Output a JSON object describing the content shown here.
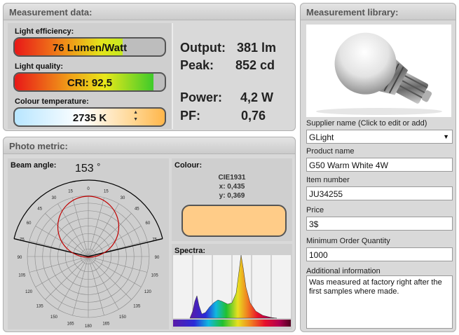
{
  "measurement_panel": {
    "title": "Measurement data:",
    "light_efficiency": {
      "label": "Light efficiency:",
      "value": "76 Lumen/Watt",
      "level": 0.72
    },
    "light_quality": {
      "label": "Light quality:",
      "value": "CRI:  92,5",
      "level": 0.925
    },
    "colour_temperature": {
      "label": "Colour temperature:",
      "value": "2735 K"
    },
    "readings": [
      {
        "label": "Output:",
        "value": "381 lm"
      },
      {
        "label": "Peak:",
        "value": "852 cd"
      },
      {
        "label": "Power:",
        "value": "4,2 W"
      },
      {
        "label": "PF:",
        "value": "0,76"
      }
    ]
  },
  "photo_panel": {
    "title": "Photo metric:",
    "beam_angle_label": "Beam angle:",
    "beam_angle_value": "153",
    "beam_angle_unit": "°",
    "polar_tick_labels": [
      "0",
      "15",
      "15",
      "30",
      "30",
      "45",
      "45",
      "60",
      "60",
      "75",
      "75",
      "90",
      "90",
      "105",
      "105",
      "120",
      "120",
      "135",
      "135",
      "150",
      "150",
      "165",
      "165",
      "180"
    ],
    "colour_label": "Colour:",
    "cie_title": "CIE1931",
    "cie_x": "x: 0,435",
    "cie_y": "y: 0,369",
    "swatch_color": "#ffcc88",
    "spectra_label": "Spectra:"
  },
  "library_panel": {
    "title": "Measurement library:",
    "fields": {
      "supplier_label": "Supplier name (Click to edit or add)",
      "supplier_value": "GLight",
      "product_label": "Product name",
      "product_value": "G50 Warm White 4W",
      "item_label": "Item number",
      "item_value": "JU34255",
      "price_label": "Price",
      "price_value": "3$",
      "moq_label": "Minimum Order Quantity",
      "moq_value": "1000",
      "info_label": "Additional information",
      "info_value": "Was measured at factory right after the first samples where made."
    }
  }
}
